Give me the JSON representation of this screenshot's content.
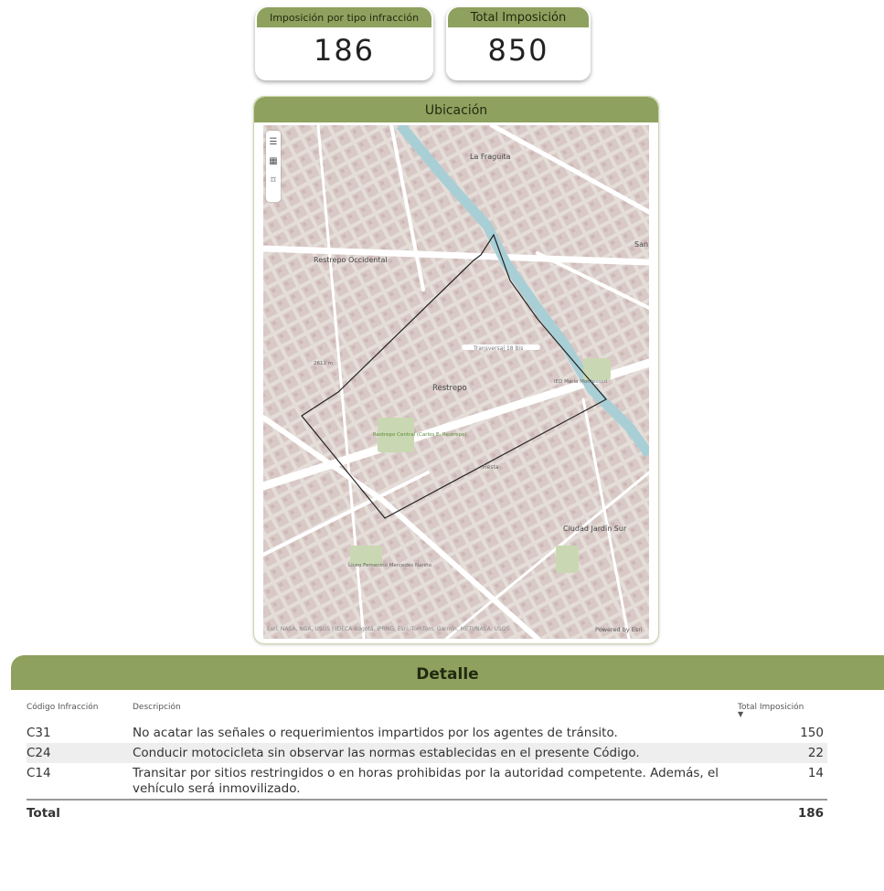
{
  "kpis": [
    {
      "title": "Imposición por tipo infracción",
      "value": "186"
    },
    {
      "title": "Total Imposición",
      "value": "850"
    }
  ],
  "map": {
    "title": "Ubicación",
    "labels": [
      "La Fraguita",
      "Restrepo Occidental",
      "Restrepo",
      "Ciudad Jardín Sur",
      "San",
      "Transversal 18 Bis",
      "IED María Montessori",
      "Restrepo Central (Carlos E. Restrepo)",
      "Liceo Femenino Mercedes Nariño",
      "2612 m",
      "Fiesta"
    ],
    "tools": [
      "menu-icon",
      "layers-icon",
      "select-icon"
    ],
    "attribution": "Esri, NASA, NGA, USGS | IDECA Bogotá, IPRNG, Esri, TomTom, Garmin, METI/NASA, USGS",
    "powered": "Powered by Esri"
  },
  "detail": {
    "title": "Detalle",
    "columns": [
      "Código Infracción",
      "Descripción",
      "Total Imposición"
    ],
    "rows": [
      {
        "code": "C31",
        "desc": "No acatar las señales o requerimientos impartidos por los agentes de tránsito.",
        "total": "150"
      },
      {
        "code": "C24",
        "desc": "Conducir motocicleta sin observar las normas establecidas en el presente Código.",
        "total": "22"
      },
      {
        "code": "C14",
        "desc": "Transitar por sitios restringidos o en horas prohibidas por la autoridad competente. Además, el vehículo será inmovilizado.",
        "total": "14"
      }
    ],
    "total_label": "Total",
    "total_value": "186"
  },
  "colors": {
    "header": "#8fa15e",
    "accent_border": "#c9d6a8",
    "map_bg": "#e2dcd6"
  }
}
